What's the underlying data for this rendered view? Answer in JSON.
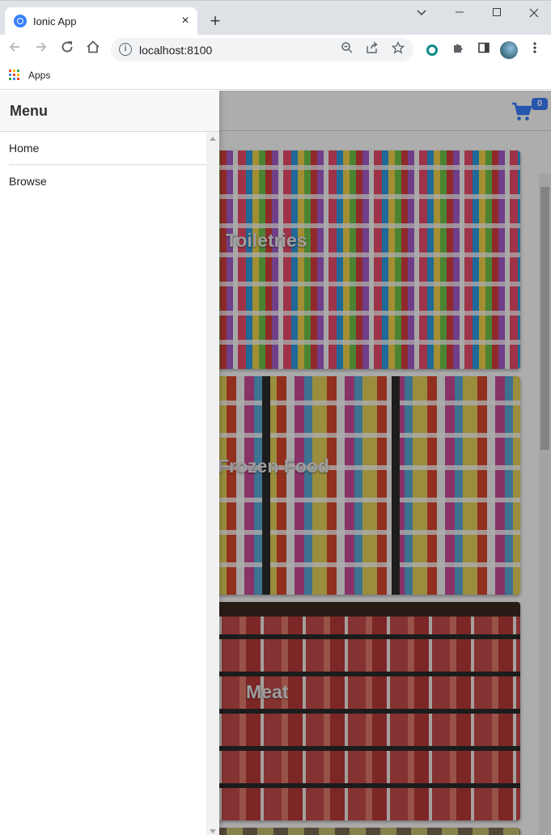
{
  "browser": {
    "tab_title": "Ionic App",
    "tab_close": "×",
    "new_tab": "+",
    "url": "localhost:8100",
    "bookmarks": [
      {
        "label": "Apps",
        "icon": "apps-grid-icon"
      }
    ],
    "icons": [
      "back-arrow-icon",
      "forward-arrow-icon",
      "reload-icon",
      "home-icon",
      "info-icon",
      "zoom-out-icon",
      "share-icon",
      "star-icon",
      "extension-icon",
      "puzzle-icon",
      "side-panel-icon",
      "profile-avatar",
      "more-vert-icon"
    ]
  },
  "menu": {
    "title": "Menu",
    "items": [
      {
        "label": "Home"
      },
      {
        "label": "Browse"
      }
    ]
  },
  "header": {
    "cart_count": "0",
    "cart_icon": "cart-icon",
    "accent": "#3880ff"
  },
  "categories": [
    {
      "title": "Toiletries"
    },
    {
      "title": "Frozen Food"
    },
    {
      "title": "Meat"
    }
  ]
}
